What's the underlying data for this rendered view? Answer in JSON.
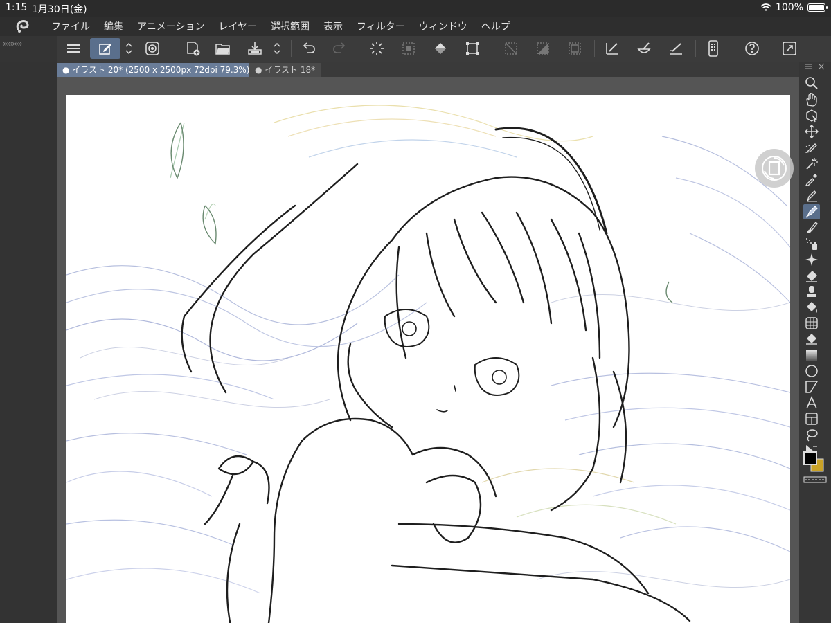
{
  "status": {
    "time": "1:15",
    "date": "1月30日(金)",
    "battery": "100%"
  },
  "menu": {
    "items": [
      "ファイル",
      "編集",
      "アニメーション",
      "レイヤー",
      "選択範囲",
      "表示",
      "フィルター",
      "ウィンドウ",
      "ヘルプ"
    ]
  },
  "toolbar": {
    "dock_arrows": "»»»»»"
  },
  "tabs": [
    {
      "label": "イラスト 20* (2500 x 2500px 72dpi 79.3%)",
      "active": true
    },
    {
      "label": "イラスト 18*",
      "active": false
    }
  ],
  "colors": {
    "main": "#000000",
    "sub": "#c9a227",
    "accent": "#5a6f8c"
  }
}
